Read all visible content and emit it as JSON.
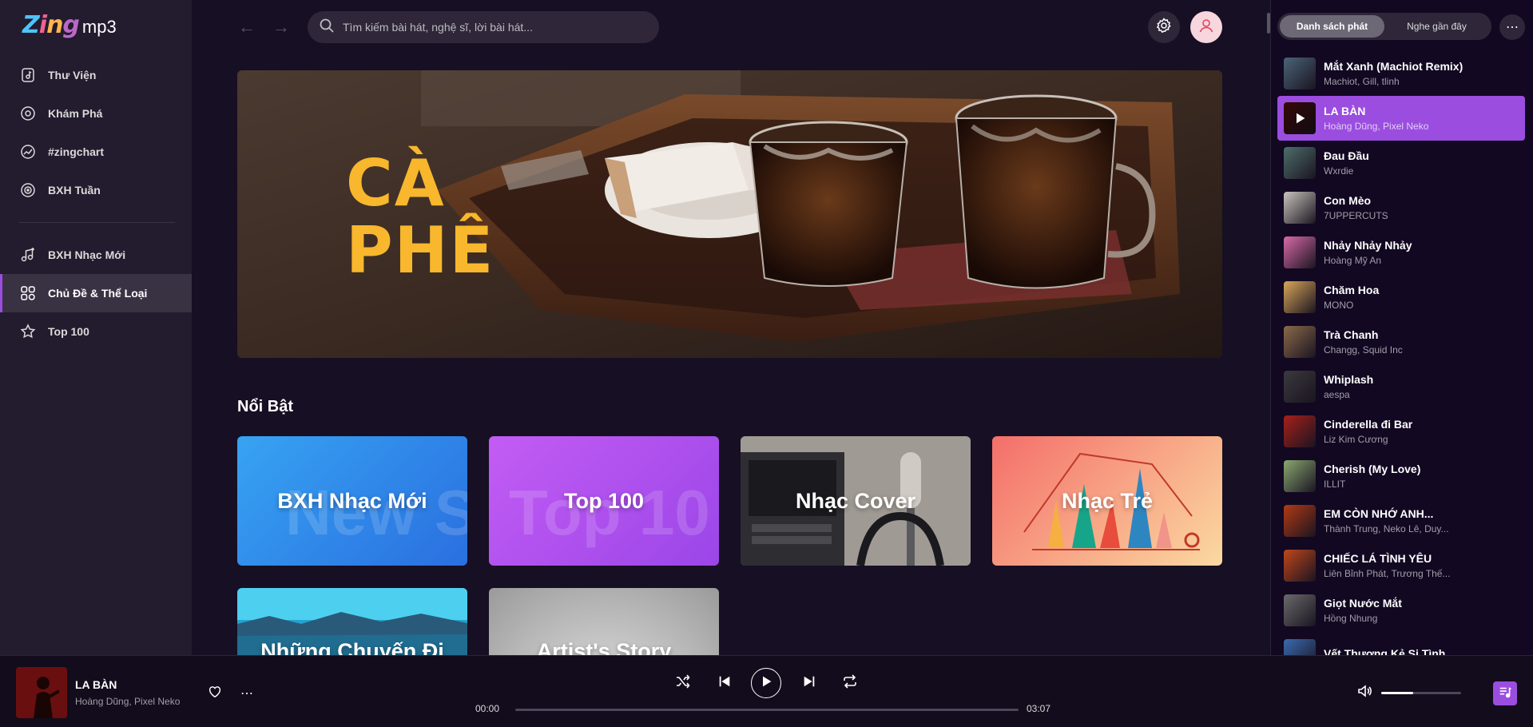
{
  "logo": {
    "zing": [
      "Z",
      "i",
      "n",
      "g"
    ],
    "mp3": "mp3"
  },
  "sidebar": {
    "items": [
      {
        "label": "Thư Viện",
        "icon": "library-icon"
      },
      {
        "label": "Khám Phá",
        "icon": "disc-icon"
      },
      {
        "label": "#zingchart",
        "icon": "chart-icon"
      },
      {
        "label": "BXH Tuần",
        "icon": "radio-icon"
      },
      {
        "label": "BXH Nhạc Mới",
        "icon": "music-plus-icon"
      },
      {
        "label": "Chủ Đề & Thể Loại",
        "icon": "category-icon"
      },
      {
        "label": "Top 100",
        "icon": "star-icon"
      }
    ],
    "active_index": 5
  },
  "header": {
    "search_placeholder": "Tìm kiếm bài hát, nghệ sĩ, lời bài hát..."
  },
  "banner": {
    "line1": "CÀ",
    "line2": "PHÊ"
  },
  "featured": {
    "title": "Nổi Bật",
    "cards": [
      {
        "label": "BXH Nhạc Mới",
        "ghost": "New S",
        "color_a": "#37a3f2",
        "color_b": "#2a6fe0"
      },
      {
        "label": "Top 100",
        "ghost": "Top 10",
        "color_a": "#c35cf4",
        "color_b": "#9b46e8"
      },
      {
        "label": "Nhạc Cover",
        "ghost": "",
        "color_a": "#4a4a4e",
        "color_b": "#8a8580"
      },
      {
        "label": "Nhạc Trẻ",
        "ghost": "",
        "color_a": "#f46e6a",
        "color_b": "#fbd9a0"
      },
      {
        "label": "Những Chuyến Đi",
        "ghost": "",
        "color_a": "#29c3f0",
        "color_b": "#0c4a6e"
      },
      {
        "label": "Artist's Story",
        "ghost": "",
        "color_a": "#d5d5d5",
        "color_b": "#9a9a9a"
      }
    ]
  },
  "right_panel": {
    "tabs": [
      "Danh sách phát",
      "Nghe gần đây"
    ],
    "active_tab": 0,
    "queue": [
      {
        "title": "Mắt Xanh (Machiot Remix)",
        "artist": "Machiot, Gill, tlinh",
        "color": "#4a6478"
      },
      {
        "title": "LA BÀN",
        "artist": "Hoàng Dũng, Pixel Neko",
        "color": "#5a0d0d"
      },
      {
        "title": "Đau Đầu",
        "artist": "Wxrdie",
        "color": "#4e6e6a"
      },
      {
        "title": "Con Mèo",
        "artist": "7UPPERCUTS",
        "color": "#c9c4bd"
      },
      {
        "title": "Nhảy Nhảy Nhảy",
        "artist": "Hoàng Mỹ An",
        "color": "#d86aa8"
      },
      {
        "title": "Chăm Hoa",
        "artist": "MONO",
        "color": "#d9a65a"
      },
      {
        "title": "Trà Chanh",
        "artist": "Changg, Squid Inc",
        "color": "#8a6a4a"
      },
      {
        "title": "Whiplash",
        "artist": "aespa",
        "color": "#3a3a3e"
      },
      {
        "title": "Cinderella đi Bar",
        "artist": "Liz Kim Cương",
        "color": "#a8201a"
      },
      {
        "title": "Cherish (My Love)",
        "artist": "ILLIT",
        "color": "#8aa870"
      },
      {
        "title": "EM CÒN NHỚ ANH...",
        "artist": "Thành Trung, Neko Lê, Duy...",
        "color": "#b33a14"
      },
      {
        "title": "CHIẾC LÁ TÌNH YÊU",
        "artist": "Liên Bỉnh Phát, Trương Thế...",
        "color": "#c0461a"
      },
      {
        "title": "Giọt Nước Mắt",
        "artist": "Hồng Nhung",
        "color": "#6a6a6a"
      },
      {
        "title": "Vết Thương Kẻ Si Tình",
        "artist": "",
        "color": "#3a6ab0"
      }
    ]
  },
  "player": {
    "title": "LA BÀN",
    "artist": "Hoàng Dũng, Pixel Neko",
    "time_current": "00:00",
    "time_total": "03:07",
    "progress": 0,
    "volume": 0.4
  },
  "colors": {
    "accent": "#9b4de0",
    "bg": "#170f23",
    "sidebar": "#231b2e",
    "banner_text": "#f8b72c"
  }
}
